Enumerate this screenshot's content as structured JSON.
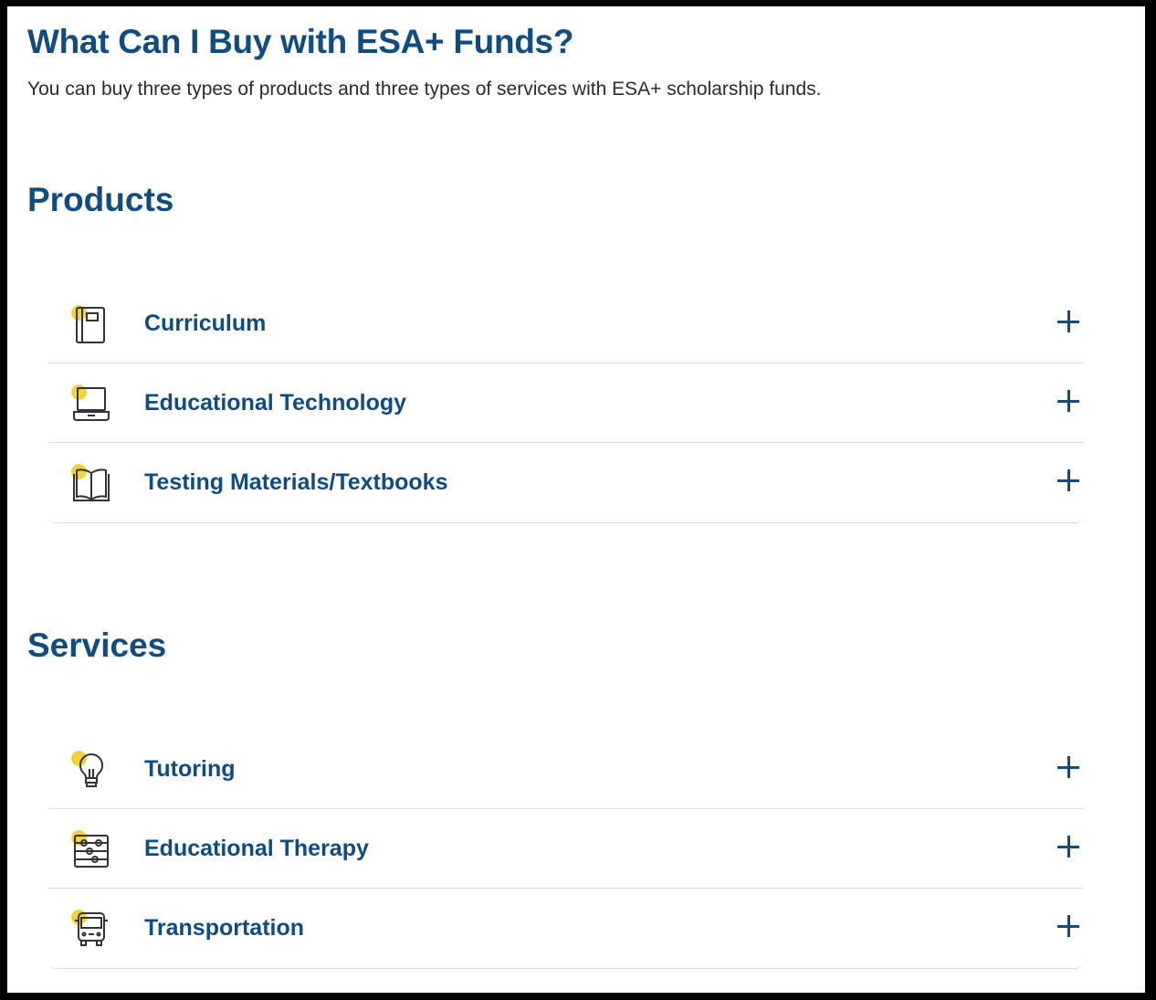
{
  "header": {
    "title": "What Can I Buy with ESA+ Funds?",
    "subtitle": "You can buy three types of products and three types of services with ESA+ scholarship funds."
  },
  "products": {
    "heading": "Products",
    "items": [
      {
        "label": "Curriculum",
        "icon": "notebook-icon"
      },
      {
        "label": "Educational Technology",
        "icon": "laptop-icon"
      },
      {
        "label": "Testing Materials/Textbooks",
        "icon": "open-book-icon"
      }
    ]
  },
  "services": {
    "heading": "Services",
    "items": [
      {
        "label": "Tutoring",
        "icon": "lightbulb-icon"
      },
      {
        "label": "Educational Therapy",
        "icon": "abacus-icon"
      },
      {
        "label": "Transportation",
        "icon": "bus-icon"
      }
    ]
  },
  "colors": {
    "brand_blue": "#0f4c81",
    "accent_yellow": "#f2d33a",
    "divider": "#d5dde6",
    "text": "#2b2b2b"
  }
}
